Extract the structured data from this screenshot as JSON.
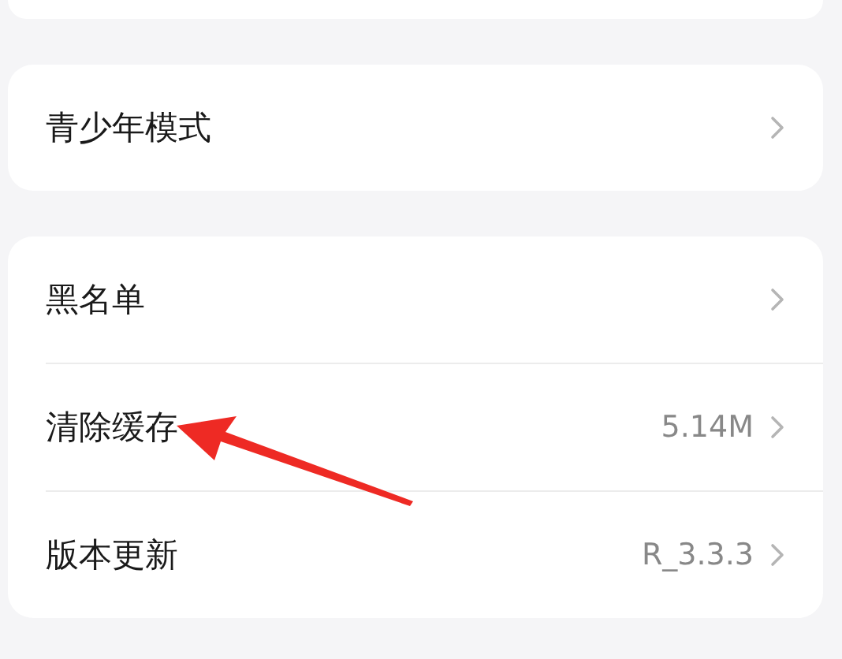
{
  "groups": [
    {
      "kind": "stub"
    },
    {
      "items": [
        {
          "label": "青少年模式"
        }
      ]
    },
    {
      "items": [
        {
          "label": "黑名单"
        },
        {
          "label": "清除缓存",
          "value": "5.14M"
        },
        {
          "label": "版本更新",
          "value": "R_3.3.3"
        }
      ]
    }
  ]
}
